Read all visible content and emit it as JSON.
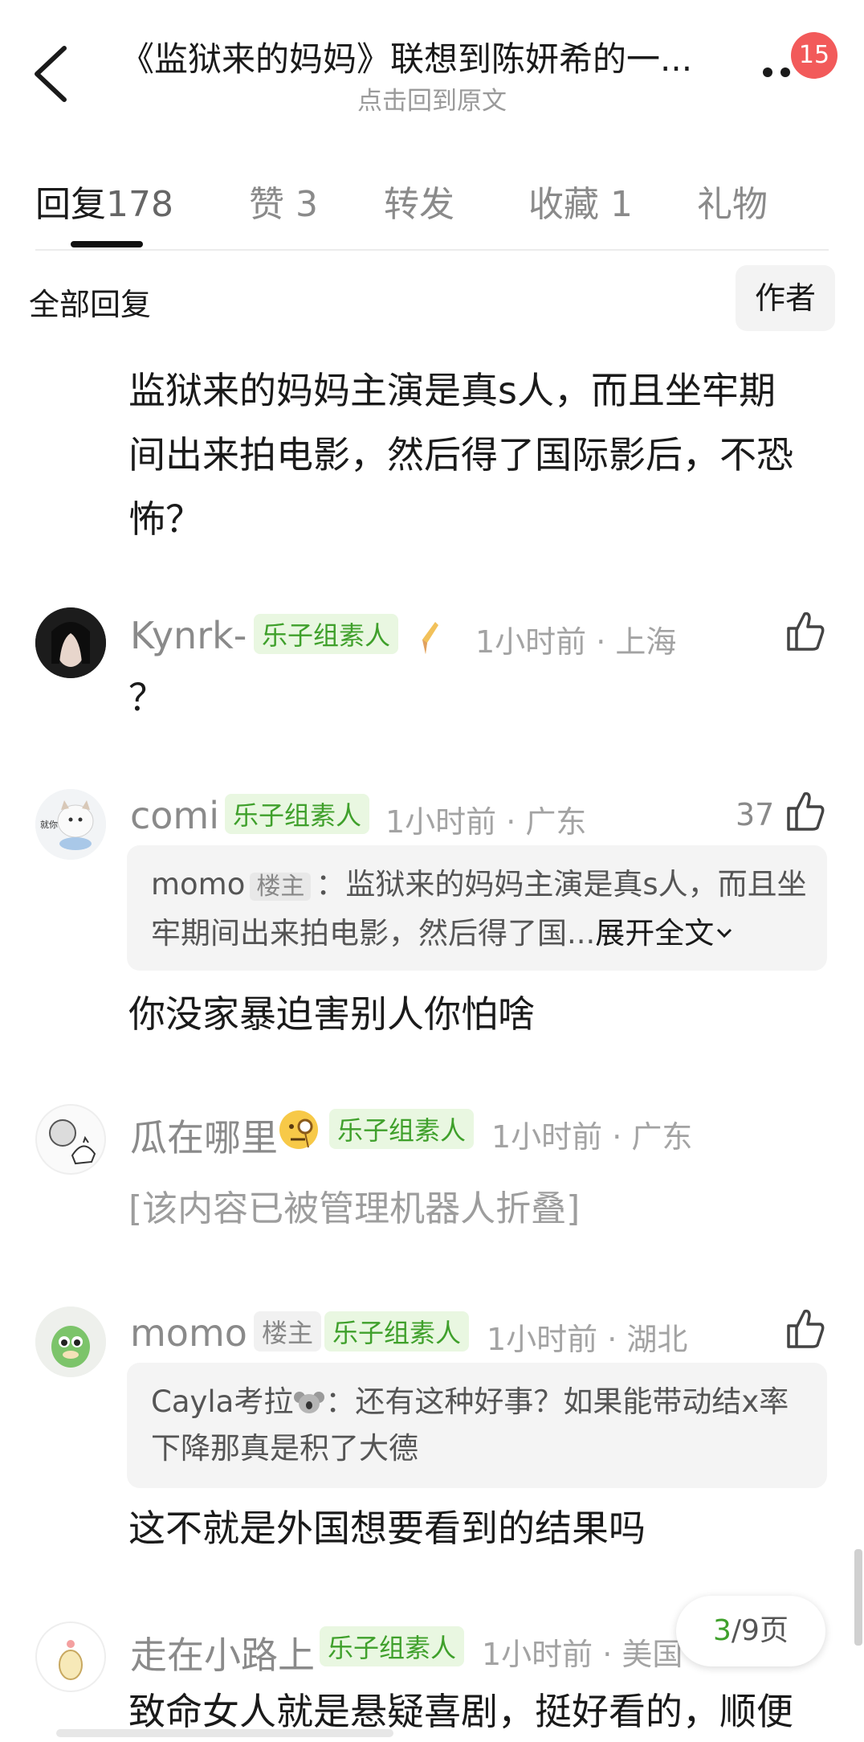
{
  "header": {
    "title": "《监狱来的妈妈》联想到陈妍希的一...",
    "subtitle": "点击回到原文",
    "badge_count": "15"
  },
  "tabs": [
    {
      "label": "回复",
      "count": "178"
    },
    {
      "label": "赞",
      "count": "3"
    },
    {
      "label": "转发",
      "count": ""
    },
    {
      "label": "收藏",
      "count": "1"
    },
    {
      "label": "礼物",
      "count": ""
    }
  ],
  "filter": {
    "label": "全部回复",
    "author_button": "作者"
  },
  "post": {
    "lines": [
      "监狱来的妈妈主演是真s人，而且坐牢期",
      "间出来拍电影，然后得了国际影后，不恐",
      "怖？"
    ]
  },
  "comments": [
    {
      "name": "Kynrk-",
      "tag": "乐子组素人",
      "time": "1小时前 · 上海",
      "body": "？"
    },
    {
      "name": "comi",
      "tag": "乐子组素人",
      "time": "1小时前 · 广东",
      "likes": "37",
      "quote": {
        "name": "momo",
        "op_tag": "楼主",
        "text": "：监狱来的妈妈主演是真s人，而且坐牢期间出来拍电影，然后得了国...",
        "expand": "展开全文"
      },
      "body": "你没家暴迫害别人你怕啥"
    },
    {
      "name": "瓜在哪里",
      "tag": "乐子组素人",
      "time": "1小时前 · 广东",
      "folded": "[该内容已被管理机器人折叠]"
    },
    {
      "name": "momo",
      "op_tag": "楼主",
      "tag": "乐子组素人",
      "time": "1小时前 · 湖北",
      "quote": {
        "name": "Cayla考拉",
        "text": "：还有这种好事？如果能带动结x率下降那真是积了大德"
      },
      "body": "这不就是外国想要看到的结果吗"
    },
    {
      "name": "走在小路上",
      "tag": "乐子组素人",
      "time": "1小时前 · 美国",
      "body": "致命女人就是悬疑喜剧，挺好看的，顺便"
    }
  ],
  "pager": {
    "current": "3",
    "total": "/9页"
  },
  "colors": {
    "accent_green": "#3fa02b",
    "badge_red": "#f25a5a"
  }
}
